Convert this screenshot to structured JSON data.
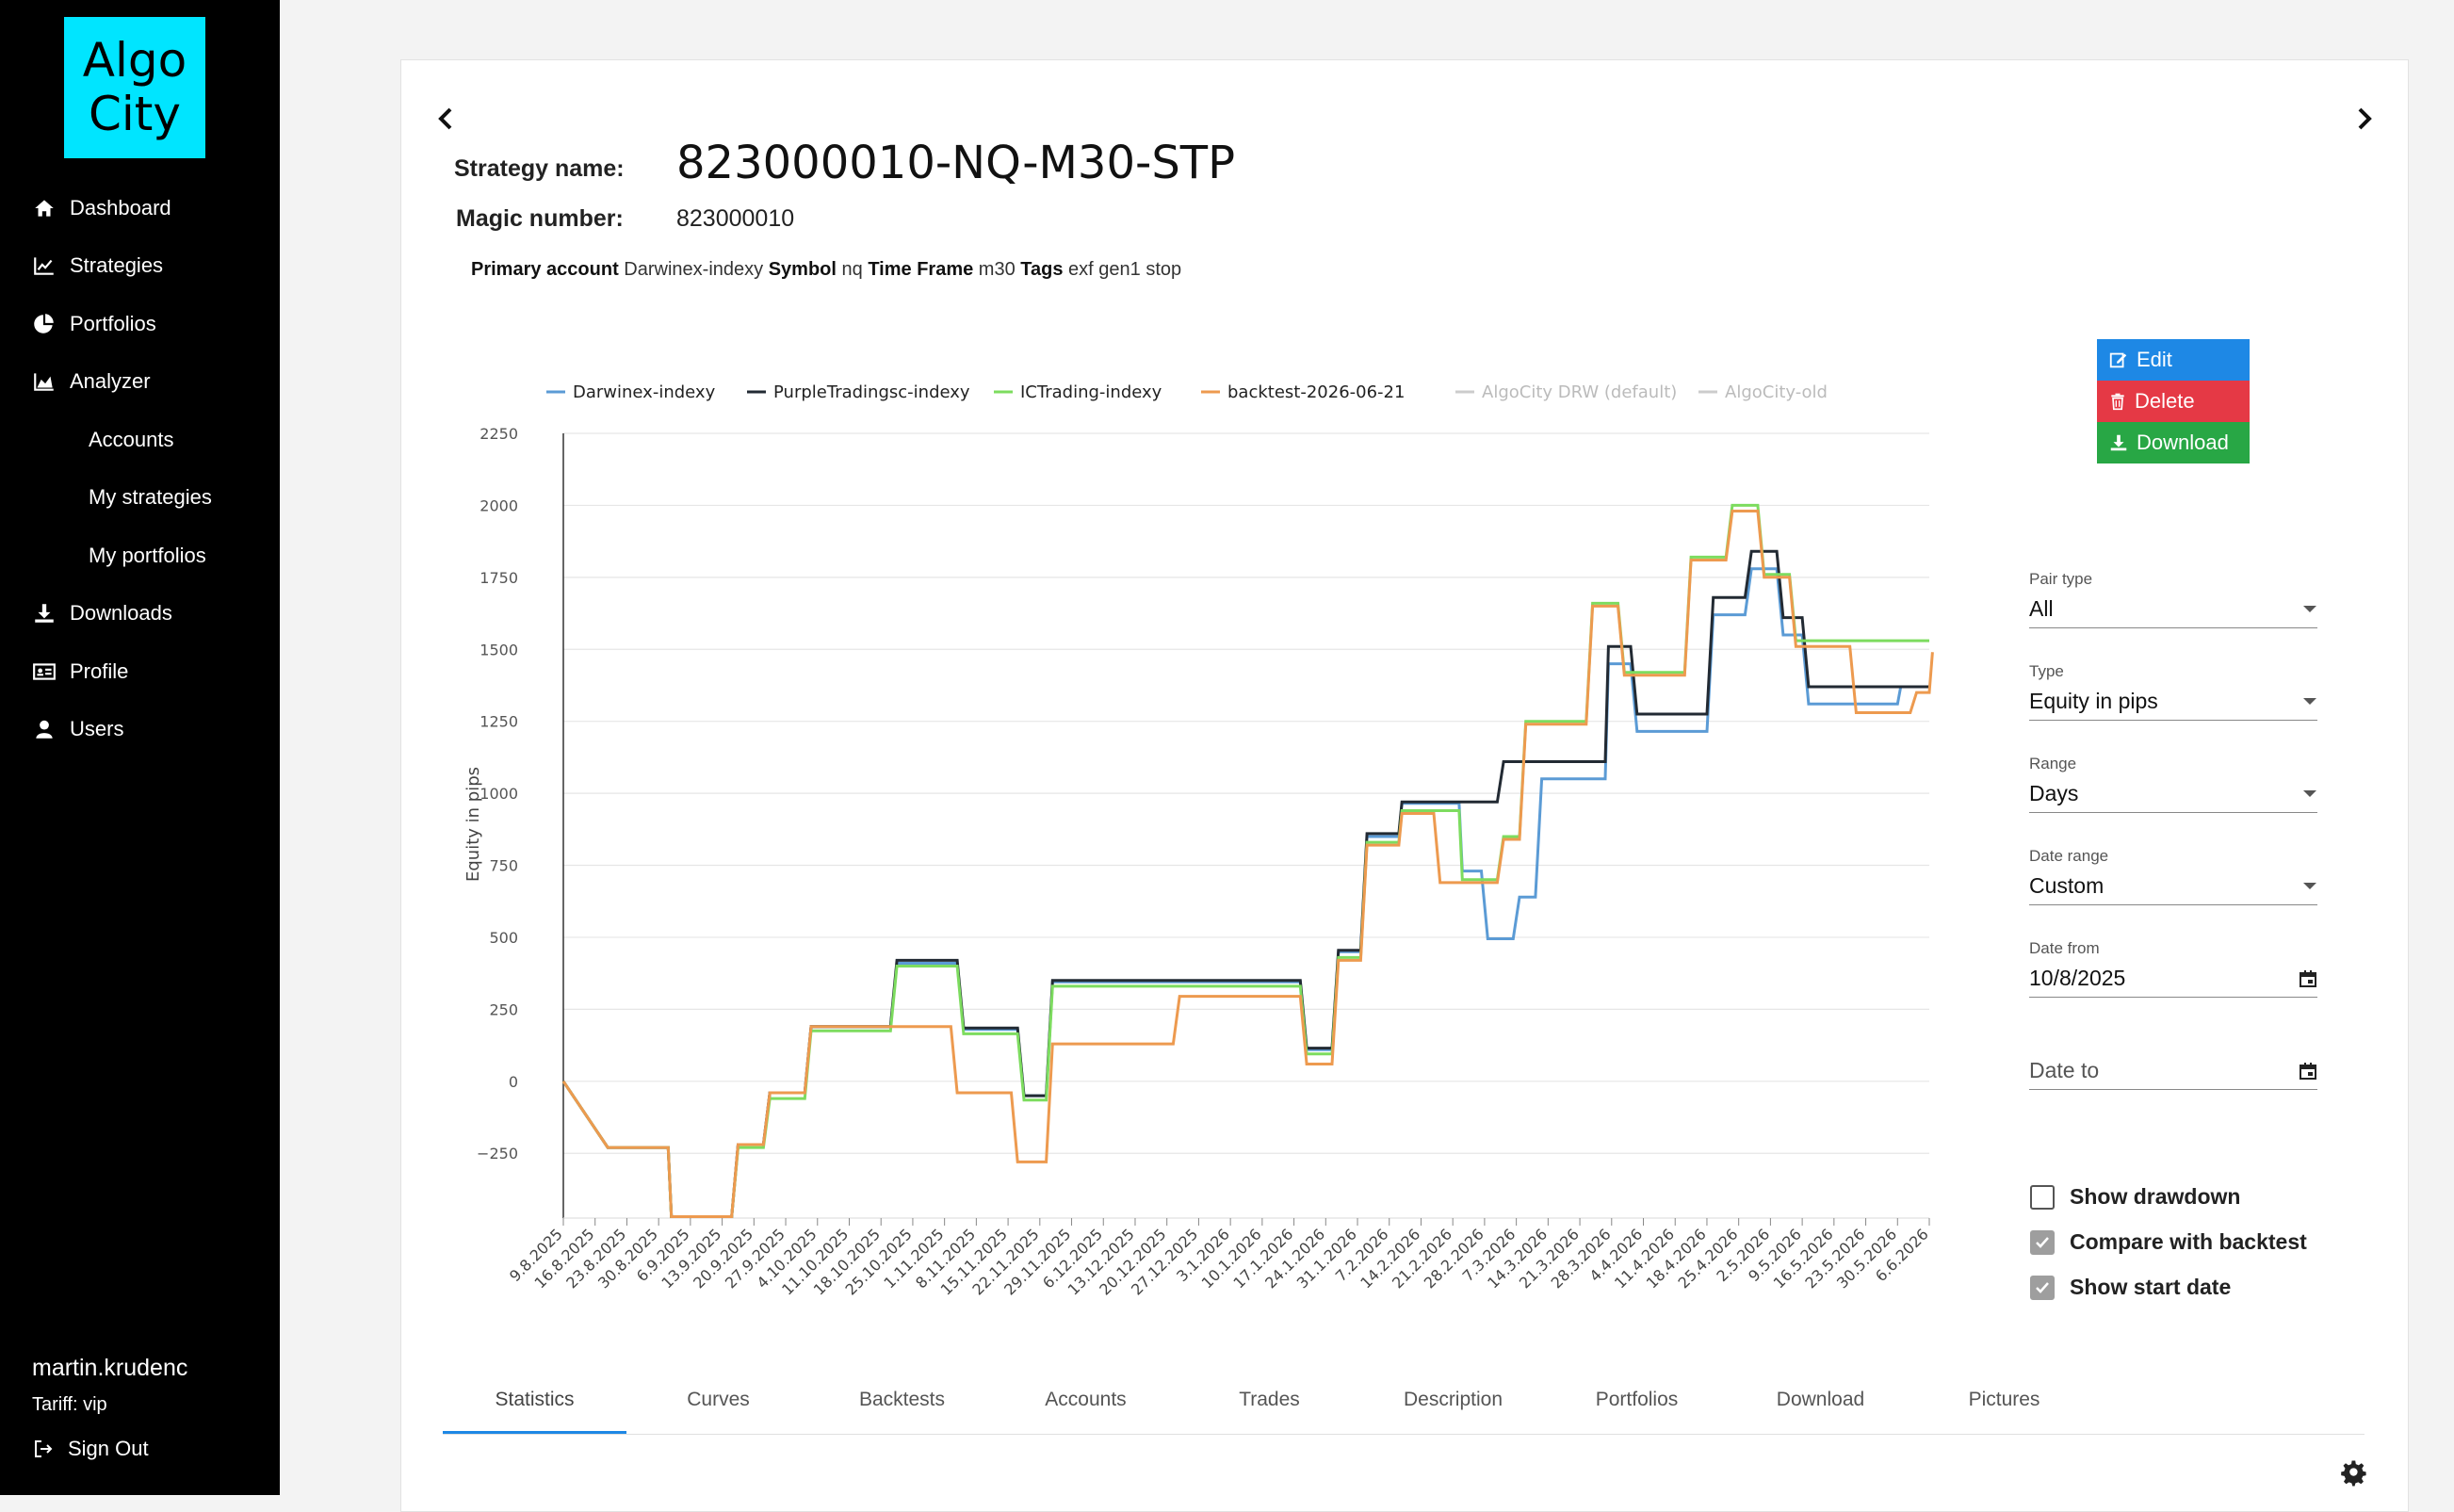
{
  "sidebar": {
    "logo_line1": "Algo",
    "logo_line2": "City",
    "items": [
      {
        "label": "Dashboard",
        "icon": "home-icon"
      },
      {
        "label": "Strategies",
        "icon": "line-chart-icon"
      },
      {
        "label": "Portfolios",
        "icon": "pie-chart-icon"
      },
      {
        "label": "Analyzer",
        "icon": "area-chart-icon"
      },
      {
        "label": "Accounts"
      },
      {
        "label": "My strategies"
      },
      {
        "label": "My portfolios"
      },
      {
        "label": "Downloads",
        "icon": "download-icon"
      },
      {
        "label": "Profile",
        "icon": "id-card-icon"
      },
      {
        "label": "Users",
        "icon": "user-icon"
      }
    ],
    "user_name": "martin.krudenc",
    "tariff": "Tariff: vip",
    "sign_out": "Sign Out"
  },
  "strategy": {
    "name_label": "Strategy name:",
    "name": "823000010-NQ-M30-STP",
    "magic_label": "Magic number:",
    "magic": "823000010",
    "meta": {
      "primary_account_label": "Primary account",
      "primary_account": "Darwinex-indexy",
      "symbol_label": "Symbol",
      "symbol": "nq",
      "timeframe_label": "Time Frame",
      "timeframe": "m30",
      "tags_label": "Tags",
      "tags": "exf gen1 stop"
    }
  },
  "actions": {
    "edit": "Edit",
    "delete": "Delete",
    "download": "Download",
    "colors": {
      "edit": "#1e88e5",
      "delete": "#e53945",
      "download": "#28a745"
    }
  },
  "controls": {
    "pair_type": {
      "label": "Pair type",
      "value": "All"
    },
    "type": {
      "label": "Type",
      "value": "Equity in pips"
    },
    "range": {
      "label": "Range",
      "value": "Days"
    },
    "date_range": {
      "label": "Date range",
      "value": "Custom"
    },
    "date_from": {
      "label": "Date from",
      "value": "10/8/2025"
    },
    "date_to": {
      "placeholder": "Date to"
    },
    "show_drawdown": {
      "label": "Show drawdown",
      "checked": false
    },
    "compare_backtest": {
      "label": "Compare with backtest",
      "checked": true
    },
    "show_start_date": {
      "label": "Show start date",
      "checked": true
    }
  },
  "tabs": [
    "Statistics",
    "Curves",
    "Backtests",
    "Accounts",
    "Trades",
    "Description",
    "Portfolios",
    "Download",
    "Pictures"
  ],
  "chart_data": {
    "type": "line",
    "ylabel": "Equity in pips",
    "ylim": [
      -475,
      2250
    ],
    "yticks": [
      2250,
      2000,
      1750,
      1500,
      1250,
      1000,
      750,
      500,
      250,
      0,
      -250
    ],
    "x_tick_labels": [
      "9.8.2025",
      "16.8.2025",
      "23.8.2025",
      "30.8.2025",
      "6.9.2025",
      "13.9.2025",
      "20.9.2025",
      "27.9.2025",
      "4.10.2025",
      "11.10.2025",
      "18.10.2025",
      "25.10.2025",
      "1.11.2025",
      "8.11.2025",
      "15.11.2025",
      "22.11.2025",
      "29.11.2025",
      "6.12.2025",
      "13.12.2025",
      "20.12.2025",
      "27.12.2025",
      "3.1.2026",
      "10.1.2026",
      "17.1.2026",
      "24.1.2026",
      "31.1.2026",
      "7.2.2026",
      "14.2.2026",
      "21.2.2026",
      "28.2.2026",
      "7.3.2026",
      "14.3.2026",
      "21.3.2026",
      "28.3.2026",
      "4.4.2026",
      "11.4.2026",
      "18.4.2026",
      "25.4.2026",
      "2.5.2026",
      "9.5.2026",
      "16.5.2026",
      "23.5.2026",
      "30.5.2026",
      "6.6.2026"
    ],
    "legend": "top",
    "grid": true,
    "series": [
      {
        "name": "Darwinex-indexy",
        "color": "#5b9bd5",
        "visible": true,
        "points": [
          [
            0,
            0
          ],
          [
            1.4,
            -230
          ],
          [
            3.3,
            -230
          ],
          [
            3.4,
            -470
          ],
          [
            5.3,
            -470
          ],
          [
            5.5,
            -220
          ],
          [
            6.3,
            -220
          ],
          [
            6.5,
            -40
          ],
          [
            7.6,
            -40
          ],
          [
            7.8,
            190
          ],
          [
            10.3,
            190
          ],
          [
            10.5,
            410
          ],
          [
            12.4,
            410
          ],
          [
            12.6,
            180
          ],
          [
            14.3,
            180
          ],
          [
            14.5,
            -50
          ],
          [
            15.2,
            -50
          ],
          [
            15.4,
            345
          ],
          [
            23.2,
            345
          ],
          [
            23.4,
            110
          ],
          [
            24.2,
            110
          ],
          [
            24.4,
            450
          ],
          [
            25.1,
            450
          ],
          [
            25.3,
            850
          ],
          [
            26.3,
            850
          ],
          [
            26.4,
            965
          ],
          [
            28.2,
            965
          ],
          [
            28.3,
            730
          ],
          [
            28.9,
            730
          ],
          [
            29.1,
            495
          ],
          [
            29.9,
            495
          ],
          [
            30.1,
            640
          ],
          [
            30.6,
            640
          ],
          [
            30.8,
            1050
          ],
          [
            32.8,
            1050
          ],
          [
            32.9,
            1450
          ],
          [
            33.6,
            1450
          ],
          [
            33.8,
            1215
          ],
          [
            36.0,
            1215
          ],
          [
            36.2,
            1620
          ],
          [
            37.2,
            1620
          ],
          [
            37.4,
            1780
          ],
          [
            38.2,
            1780
          ],
          [
            38.4,
            1550
          ],
          [
            39.0,
            1550
          ],
          [
            39.2,
            1310
          ],
          [
            42.0,
            1310
          ],
          [
            42.1,
            1370
          ],
          [
            43.0,
            1370
          ]
        ]
      },
      {
        "name": "PurpleTradingsc-indexy",
        "color": "#222a33",
        "visible": true,
        "points": [
          [
            0,
            0
          ],
          [
            1.4,
            -230
          ],
          [
            3.3,
            -230
          ],
          [
            3.4,
            -470
          ],
          [
            5.3,
            -470
          ],
          [
            5.5,
            -220
          ],
          [
            6.3,
            -220
          ],
          [
            6.5,
            -40
          ],
          [
            7.6,
            -40
          ],
          [
            7.8,
            190
          ],
          [
            10.3,
            190
          ],
          [
            10.5,
            420
          ],
          [
            12.4,
            420
          ],
          [
            12.6,
            185
          ],
          [
            14.3,
            185
          ],
          [
            14.5,
            -50
          ],
          [
            15.2,
            -50
          ],
          [
            15.4,
            350
          ],
          [
            23.2,
            350
          ],
          [
            23.4,
            115
          ],
          [
            24.2,
            115
          ],
          [
            24.4,
            455
          ],
          [
            25.1,
            455
          ],
          [
            25.3,
            860
          ],
          [
            26.3,
            860
          ],
          [
            26.4,
            970
          ],
          [
            29.4,
            970
          ],
          [
            29.6,
            1110
          ],
          [
            32.8,
            1110
          ],
          [
            32.9,
            1510
          ],
          [
            33.6,
            1510
          ],
          [
            33.8,
            1275
          ],
          [
            36.0,
            1275
          ],
          [
            36.2,
            1680
          ],
          [
            37.2,
            1680
          ],
          [
            37.4,
            1840
          ],
          [
            38.2,
            1840
          ],
          [
            38.4,
            1610
          ],
          [
            39.0,
            1610
          ],
          [
            39.2,
            1370
          ],
          [
            43.0,
            1370
          ]
        ]
      },
      {
        "name": "ICTrading-indexy",
        "color": "#7ddc5f",
        "visible": true,
        "points": [
          [
            0,
            0
          ],
          [
            1.4,
            -230
          ],
          [
            3.3,
            -230
          ],
          [
            3.4,
            -470
          ],
          [
            5.3,
            -470
          ],
          [
            5.5,
            -230
          ],
          [
            6.3,
            -230
          ],
          [
            6.5,
            -60
          ],
          [
            7.6,
            -60
          ],
          [
            7.8,
            175
          ],
          [
            10.3,
            175
          ],
          [
            10.5,
            400
          ],
          [
            12.4,
            400
          ],
          [
            12.6,
            165
          ],
          [
            14.3,
            165
          ],
          [
            14.5,
            -65
          ],
          [
            15.2,
            -65
          ],
          [
            15.4,
            330
          ],
          [
            23.2,
            330
          ],
          [
            23.4,
            95
          ],
          [
            24.2,
            95
          ],
          [
            24.4,
            430
          ],
          [
            25.1,
            430
          ],
          [
            25.3,
            830
          ],
          [
            26.3,
            830
          ],
          [
            26.4,
            940
          ],
          [
            28.2,
            940
          ],
          [
            28.3,
            700
          ],
          [
            29.4,
            700
          ],
          [
            29.6,
            850
          ],
          [
            30.1,
            850
          ],
          [
            30.3,
            1250
          ],
          [
            32.2,
            1250
          ],
          [
            32.4,
            1660
          ],
          [
            33.2,
            1660
          ],
          [
            33.4,
            1420
          ],
          [
            35.3,
            1420
          ],
          [
            35.5,
            1820
          ],
          [
            36.6,
            1820
          ],
          [
            36.8,
            2000
          ],
          [
            37.6,
            2000
          ],
          [
            37.8,
            1760
          ],
          [
            38.6,
            1760
          ],
          [
            38.8,
            1530
          ],
          [
            43.0,
            1530
          ]
        ]
      },
      {
        "name": "backtest-2026-06-21",
        "color": "#ed9a4f",
        "visible": true,
        "points": [
          [
            0,
            0
          ],
          [
            1.4,
            -230
          ],
          [
            3.3,
            -230
          ],
          [
            3.4,
            -470
          ],
          [
            5.3,
            -470
          ],
          [
            5.5,
            -220
          ],
          [
            6.3,
            -220
          ],
          [
            6.5,
            -40
          ],
          [
            7.6,
            -40
          ],
          [
            7.8,
            190
          ],
          [
            12.2,
            190
          ],
          [
            12.4,
            -40
          ],
          [
            14.1,
            -40
          ],
          [
            14.3,
            -280
          ],
          [
            15.2,
            -280
          ],
          [
            15.4,
            130
          ],
          [
            19.2,
            130
          ],
          [
            19.4,
            295
          ],
          [
            23.2,
            295
          ],
          [
            23.4,
            60
          ],
          [
            24.2,
            60
          ],
          [
            24.4,
            420
          ],
          [
            25.1,
            420
          ],
          [
            25.3,
            820
          ],
          [
            26.3,
            820
          ],
          [
            26.4,
            930
          ],
          [
            27.4,
            930
          ],
          [
            27.6,
            690
          ],
          [
            29.4,
            690
          ],
          [
            29.6,
            840
          ],
          [
            30.1,
            840
          ],
          [
            30.3,
            1240
          ],
          [
            32.2,
            1240
          ],
          [
            32.4,
            1650
          ],
          [
            33.2,
            1650
          ],
          [
            33.4,
            1410
          ],
          [
            35.3,
            1410
          ],
          [
            35.5,
            1810
          ],
          [
            36.6,
            1810
          ],
          [
            36.8,
            1980
          ],
          [
            37.6,
            1980
          ],
          [
            37.8,
            1750
          ],
          [
            38.6,
            1750
          ],
          [
            38.8,
            1510
          ],
          [
            40.5,
            1510
          ],
          [
            40.7,
            1280
          ],
          [
            42.4,
            1280
          ],
          [
            42.6,
            1350
          ],
          [
            43.0,
            1350
          ],
          [
            43.1,
            1490
          ]
        ]
      },
      {
        "name": "AlgoCity DRW (default)",
        "color": "#cccccc",
        "visible": false,
        "points": []
      },
      {
        "name": "AlgoCity-old",
        "color": "#cccccc",
        "visible": false,
        "points": []
      }
    ]
  }
}
